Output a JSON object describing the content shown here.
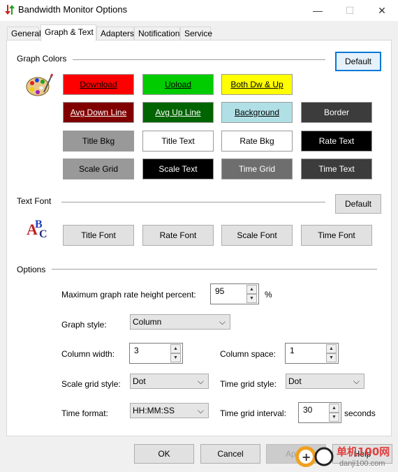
{
  "window": {
    "title": "Bandwidth Monitor Options",
    "minimize": "—",
    "maximize": "☐",
    "close": "✕"
  },
  "tabs": [
    {
      "label": "General"
    },
    {
      "label": "Graph & Text"
    },
    {
      "label": "Adapters"
    },
    {
      "label": "Notification"
    },
    {
      "label": "Service"
    }
  ],
  "graph_colors": {
    "label": "Graph Colors",
    "default_label": "Default",
    "buttons": [
      {
        "label": "Download",
        "bg": "#ff0000",
        "fg": "#000000"
      },
      {
        "label": "Upload",
        "bg": "#00cc00",
        "fg": "#000000"
      },
      {
        "label": "Both Dw & Up",
        "bg": "#ffff00",
        "fg": "#000000"
      },
      {
        "label": "Avg Down Line",
        "bg": "#800000",
        "fg": "#ffffff"
      },
      {
        "label": "Avg Up Line",
        "bg": "#006400",
        "fg": "#ffffff"
      },
      {
        "label": "Background",
        "bg": "#b0e0e6",
        "fg": "#000000"
      },
      {
        "label": "Border",
        "bg": "#3c3c3c",
        "fg": "#ffffff"
      },
      {
        "label": "Title Bkg",
        "bg": "#999999",
        "fg": "#000000"
      },
      {
        "label": "Title Text",
        "bg": "#ffffff",
        "fg": "#000000"
      },
      {
        "label": "Rate Bkg",
        "bg": "#ffffff",
        "fg": "#000000"
      },
      {
        "label": "Rate Text",
        "bg": "#000000",
        "fg": "#ffffff"
      },
      {
        "label": "Scale Grid",
        "bg": "#999999",
        "fg": "#000000"
      },
      {
        "label": "Scale Text",
        "bg": "#000000",
        "fg": "#ffffff"
      },
      {
        "label": "Time Grid",
        "bg": "#6e6e6e",
        "fg": "#ffffff"
      },
      {
        "label": "Time Text",
        "bg": "#3c3c3c",
        "fg": "#ffffff"
      }
    ]
  },
  "text_font": {
    "label": "Text Font",
    "default_label": "Default",
    "buttons": [
      "Title Font",
      "Rate Font",
      "Scale Font",
      "Time Font"
    ]
  },
  "options": {
    "label": "Options",
    "max_rate_label": "Maximum graph rate height percent:",
    "max_rate_value": "95",
    "percent_sign": "%",
    "graph_style_label": "Graph style:",
    "graph_style_value": "Column",
    "column_width_label": "Column width:",
    "column_width_value": "3",
    "column_space_label": "Column space:",
    "column_space_value": "1",
    "scale_grid_style_label": "Scale grid style:",
    "scale_grid_style_value": "Dot",
    "time_grid_style_label": "Time grid style:",
    "time_grid_style_value": "Dot",
    "time_format_label": "Time format:",
    "time_format_value": "HH:MM:SS",
    "time_grid_interval_label": "Time grid interval:",
    "time_grid_interval_value": "30",
    "seconds_label": "seconds"
  },
  "footer": {
    "ok": "OK",
    "cancel": "Cancel",
    "apply": "Apply",
    "help": "Help"
  },
  "watermark": {
    "site_cn": "单机100网",
    "site_url": "danji100.com"
  }
}
